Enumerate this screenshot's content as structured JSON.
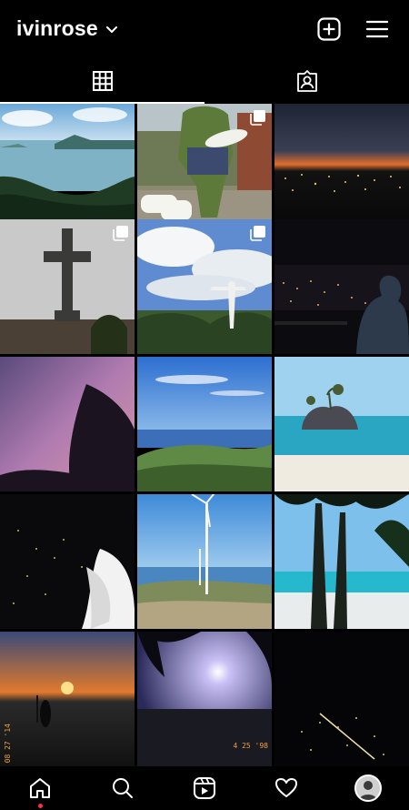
{
  "header": {
    "username": "ivinrose",
    "switch_icon": "chevron-down-icon",
    "create_icon": "plus-square-icon",
    "menu_icon": "hamburger-menu-icon"
  },
  "tabs": [
    {
      "name": "posts",
      "icon": "grid-icon",
      "active": true
    },
    {
      "name": "tagged",
      "icon": "tagged-person-icon",
      "active": false
    }
  ],
  "posts": [
    {
      "scene": "lake view with volcano island",
      "multi": false
    },
    {
      "scene": "hulk statue at roadside",
      "multi": true
    },
    {
      "scene": "city lights at dusk",
      "multi": false
    },
    {
      "scene": "stone cross on hill",
      "multi": true
    },
    {
      "scene": "christ statue under clouds",
      "multi": true
    },
    {
      "scene": "night city lights with person",
      "multi": false
    },
    {
      "scene": "purple sunset sky with trees",
      "multi": false
    },
    {
      "scene": "rolling green hills and sea",
      "multi": false
    },
    {
      "scene": "rock islet on white beach",
      "multi": false
    },
    {
      "scene": "airplane window at night",
      "multi": false
    },
    {
      "scene": "wind turbine on hill",
      "multi": false
    },
    {
      "scene": "palm trees on beach",
      "multi": false
    },
    {
      "scene": "sunset at sea with silhouettes",
      "multi": false
    },
    {
      "scene": "sun through palm leaves",
      "multi": false
    },
    {
      "scene": "city lights from airplane",
      "multi": false
    }
  ],
  "photo_stamps": [
    "08 27 '14",
    "4 25 '98"
  ],
  "bottom_nav": [
    {
      "name": "home",
      "icon": "home-icon",
      "notification_dot": true
    },
    {
      "name": "search",
      "icon": "search-icon"
    },
    {
      "name": "reels",
      "icon": "reels-icon"
    },
    {
      "name": "activity",
      "icon": "heart-icon"
    },
    {
      "name": "profile",
      "icon": "profile-avatar"
    }
  ],
  "colors": {
    "background": "#000000",
    "text": "#ffffff",
    "notification": "#ff3040"
  }
}
